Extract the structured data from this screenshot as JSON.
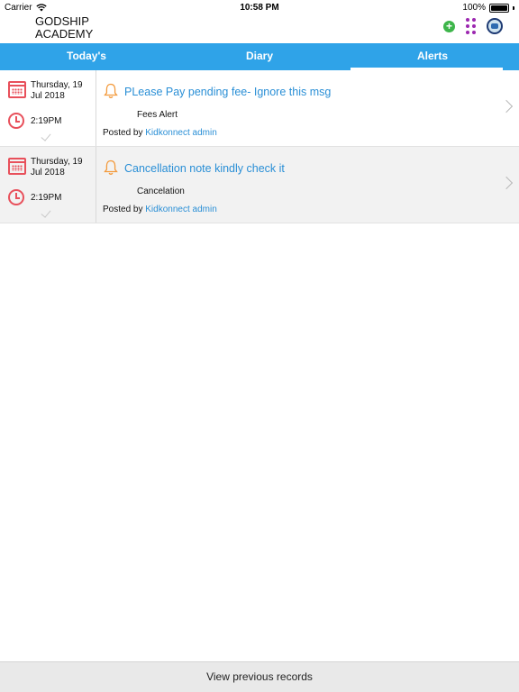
{
  "status_bar": {
    "carrier": "Carrier",
    "time": "10:58 PM",
    "battery": "100%",
    "battery_level": 1.0,
    "wifi_icon": "wifi-icon"
  },
  "header": {
    "school_name": "GODSHIP ACADEMY",
    "icons": [
      "plus-icon",
      "apps-grid-icon",
      "school-crest-icon"
    ],
    "plus_color": "#3db54a",
    "grid_color": "#9c27b0"
  },
  "tabs": [
    {
      "label": "Today's",
      "active": false
    },
    {
      "label": "Diary",
      "active": false
    },
    {
      "label": "Alerts",
      "active": true
    }
  ],
  "accent_color": "#2fa3e8",
  "alerts": [
    {
      "date": "Thursday, 19 Jul 2018",
      "time": "2:19PM",
      "title": "PLease Pay pending fee- Ignore this msg",
      "category": "Fees Alert",
      "posted_by_label": "Posted by",
      "author": "Kidkonnect admin"
    },
    {
      "date": "Thursday, 19 Jul 2018",
      "time": "2:19PM",
      "title": "Cancellation note kindly check it",
      "category": "Cancelation",
      "posted_by_label": "Posted by",
      "author": "Kidkonnect admin"
    }
  ],
  "footer": {
    "view_previous_label": "View previous records"
  }
}
